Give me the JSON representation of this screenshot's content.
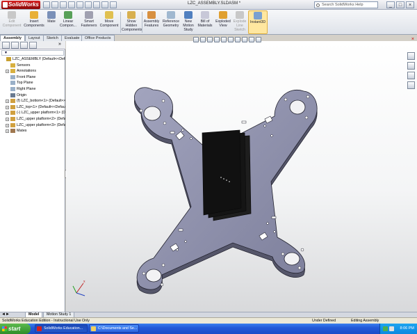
{
  "window": {
    "app_logo": "SolidWorks",
    "doc_title": "LZC_ASSEMBLY.SLDASM *",
    "search_placeholder": "Search SolidWorks Help",
    "minimize": "_",
    "restore": "□",
    "close": "×"
  },
  "command_manager": [
    {
      "label": "Edit Component",
      "disabled": true
    },
    {
      "label": "Insert Components",
      "disabled": false
    },
    {
      "label": "Mate",
      "disabled": false
    },
    {
      "label": "Linear Compon...",
      "disabled": false
    },
    {
      "label": "Smart Fasteners",
      "disabled": false
    },
    {
      "label": "Move Component",
      "disabled": false
    },
    {
      "label": "Show Hidden Components",
      "disabled": false
    },
    {
      "label": "Assembly Features",
      "disabled": false
    },
    {
      "label": "Reference Geometry",
      "disabled": false
    },
    {
      "label": "New Motion Study",
      "disabled": false
    },
    {
      "label": "Bill of Materials",
      "disabled": false
    },
    {
      "label": "Exploded View",
      "disabled": false
    },
    {
      "label": "Explode Line Sketch",
      "disabled": true
    },
    {
      "label": "Instant3D",
      "disabled": false,
      "active": true
    }
  ],
  "command_tabs": [
    "Assembly",
    "Layout",
    "Sketch",
    "Evaluate",
    "Office Products"
  ],
  "feature_tree": {
    "filter": "▼",
    "nodes": [
      {
        "label": "LZC_ASSEMBLY  (Default<<Default",
        "indent": 0,
        "expand": "",
        "icon": "assembly-icon",
        "color": "#c8a030"
      },
      {
        "label": "Sensors",
        "indent": 1,
        "expand": "",
        "icon": "sensors-icon",
        "color": "#d8b040"
      },
      {
        "label": "Annotations",
        "indent": 1,
        "expand": "+",
        "icon": "annotations-icon",
        "color": "#d8b040"
      },
      {
        "label": "Front Plane",
        "indent": 1,
        "expand": "",
        "icon": "plane-icon",
        "color": "#9ab0c8"
      },
      {
        "label": "Top Plane",
        "indent": 1,
        "expand": "",
        "icon": "plane-icon",
        "color": "#9ab0c8"
      },
      {
        "label": "Right Plane",
        "indent": 1,
        "expand": "",
        "icon": "plane-icon",
        "color": "#9ab0c8"
      },
      {
        "label": "Origin",
        "indent": 1,
        "expand": "",
        "icon": "origin-icon",
        "color": "#6a7a90"
      },
      {
        "label": "(f) LZC_bottom<1> (Default<<",
        "indent": 1,
        "expand": "+",
        "icon": "part-icon",
        "color": "#d0a040"
      },
      {
        "label": "LZC_top<1> (Default<<Default",
        "indent": 1,
        "expand": "+",
        "icon": "part-icon",
        "color": "#d0a040"
      },
      {
        "label": "(-) LZC_upper platform<1> (De",
        "indent": 1,
        "expand": "+",
        "icon": "part-icon",
        "color": "#d0a040"
      },
      {
        "label": "LZC_upper platform<2> (Defau",
        "indent": 1,
        "expand": "+",
        "icon": "part-icon",
        "color": "#d0a040"
      },
      {
        "label": "LZC_upper platform<3> (Defau",
        "indent": 1,
        "expand": "+",
        "icon": "part-icon",
        "color": "#d0a040"
      },
      {
        "label": "Mates",
        "indent": 1,
        "expand": "+",
        "icon": "mates-icon",
        "color": "#a07850"
      }
    ]
  },
  "model_tabs": [
    "Model",
    "Motion Study 1"
  ],
  "status": {
    "edition": "SolidWorks Education Edition - Instructional Use Only",
    "state": "Under Defined",
    "mode": "Editing Assembly"
  },
  "taskbar": {
    "start": "start",
    "items": [
      "SolidWorks Education...",
      "C:\\Documents and Se..."
    ],
    "clock": "8:06 PM"
  },
  "colors": {
    "part_fill": "#8a8ca8",
    "part_edge": "#2a2a3a",
    "board_fill": "#151515",
    "accent": "#0a50c8"
  }
}
